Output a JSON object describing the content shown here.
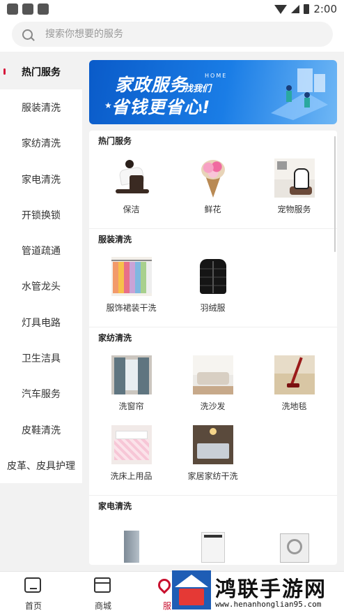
{
  "status_bar": {
    "time": "2:00"
  },
  "search": {
    "placeholder": "搜索你想要的服务"
  },
  "sidebar": {
    "items": [
      {
        "label": "热门服务",
        "active": true
      },
      {
        "label": "服装清洗"
      },
      {
        "label": "家纺清洗"
      },
      {
        "label": "家电清洗"
      },
      {
        "label": "开锁换锁"
      },
      {
        "label": "管道疏通"
      },
      {
        "label": "水管龙头"
      },
      {
        "label": "灯具电路"
      },
      {
        "label": "卫生洁具"
      },
      {
        "label": "汽车服务"
      },
      {
        "label": "皮鞋清洗"
      },
      {
        "label": "皮革、皮具护理"
      }
    ]
  },
  "banner": {
    "line1": "家政服务",
    "home": "HOME",
    "sub": "找我们",
    "line2": "省钱更省心!",
    "accent_color": "#1a6fd8"
  },
  "sections": {
    "hot": {
      "title": "热门服务",
      "items": [
        {
          "label": "保洁",
          "icon": "cleaning-photo"
        },
        {
          "label": "鲜花",
          "icon": "flower-bouquet-photo"
        },
        {
          "label": "宠物服务",
          "icon": "pet-photo"
        }
      ]
    },
    "clothing": {
      "title": "服装清洗",
      "items": [
        {
          "label": "服饰裙装干洗",
          "icon": "clothes-rack-photo"
        },
        {
          "label": "羽绒服",
          "icon": "down-jacket-photo"
        }
      ]
    },
    "textile": {
      "title": "家纺清洗",
      "items": [
        {
          "label": "洗窗帘",
          "icon": "curtain-photo"
        },
        {
          "label": "洗沙发",
          "icon": "sofa-photo"
        },
        {
          "label": "洗地毯",
          "icon": "carpet-photo"
        },
        {
          "label": "洗床上用品",
          "icon": "bedding-photo"
        },
        {
          "label": "家居家纺干洗",
          "icon": "home-textile-photo"
        }
      ]
    },
    "appliance": {
      "title": "家电清洗"
    }
  },
  "bottom_nav": {
    "items": [
      {
        "label": "首页"
      },
      {
        "label": "商城"
      },
      {
        "label": "服"
      }
    ],
    "active_color": "#c8102e"
  },
  "watermark": {
    "title": "鸿联手游网",
    "url": "www.henanhonglian95.com"
  }
}
